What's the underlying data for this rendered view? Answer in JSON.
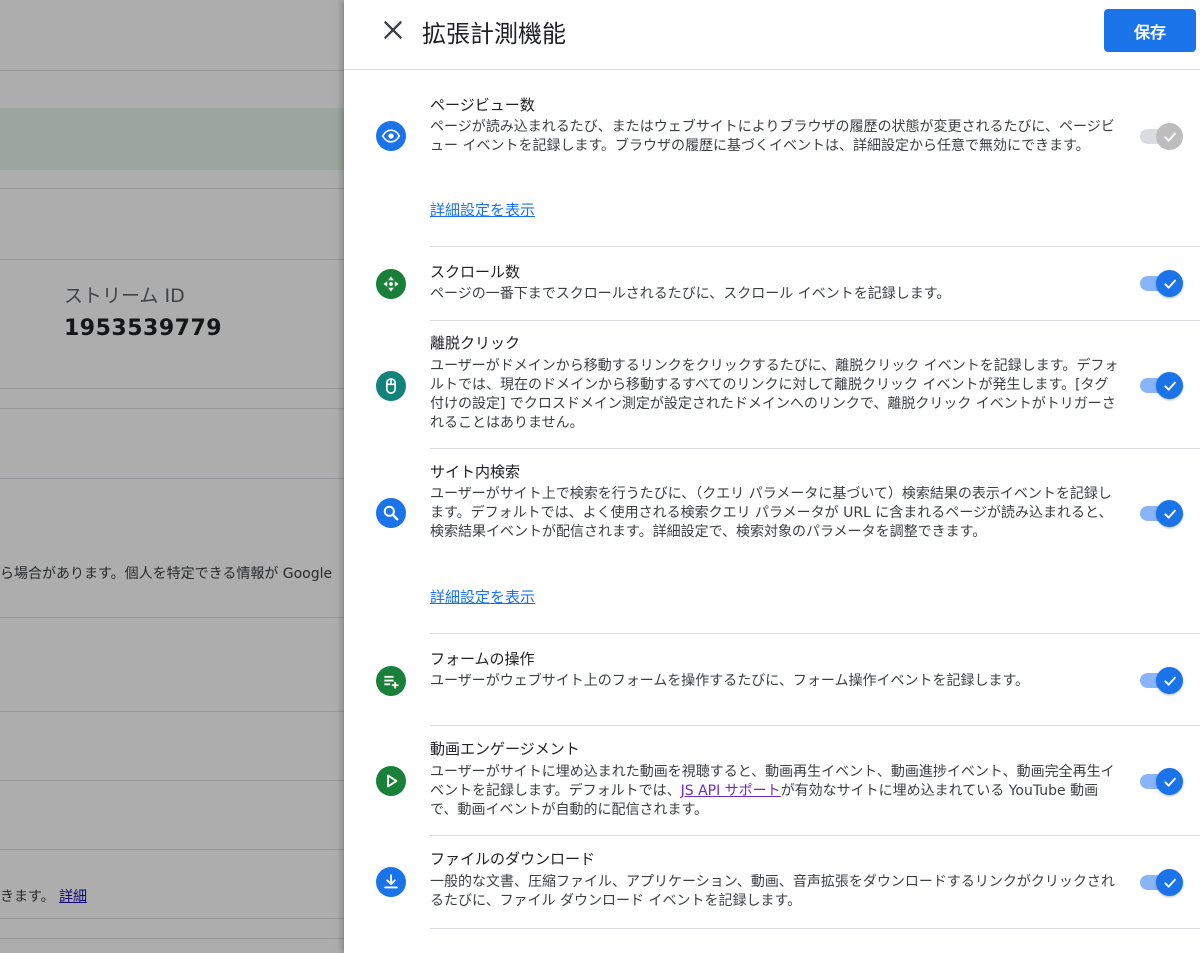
{
  "background": {
    "stream_label": "ストリーム ID",
    "stream_id": "1953539779",
    "note_fragment": "ら場合があります。個人を特定できる情報が Google",
    "note2_text": "きます。",
    "note2_link": "詳細"
  },
  "panel": {
    "title": "拡張計測機能",
    "save_label": "保存",
    "close_icon": "close-icon",
    "advanced_link": "詳細設定を表示"
  },
  "features": [
    {
      "title": "ページビュー数",
      "description": "ページが読み込まれるたび、またはウェブサイトによりブラウザの履歴の状態が変更されるたびに、ページビュー イベントを記録します。ブラウザの履歴に基づくイベントは、詳細設定から任意で無効にできます。",
      "icon": "eye-icon",
      "icon_color": "#1a73e8",
      "enabled": true,
      "toggle_disabled": true,
      "link": "詳細設定を表示"
    },
    {
      "title": "スクロール数",
      "description": "ページの一番下までスクロールされるたびに、スクロール イベントを記録します。",
      "icon": "scroll-icon",
      "icon_color": "#188038",
      "enabled": true
    },
    {
      "title": "離脱クリック",
      "description": "ユーザーがドメインから移動するリンクをクリックするたびに、離脱クリック イベントを記録します。デフォルトでは、現在のドメインから移動するすべてのリンクに対して離脱クリック イベントが発生します。[タグ付けの設定] でクロスドメイン測定が設定されたドメインへのリンクで、離脱クリック イベントがトリガーされることはありません。",
      "icon": "mouse-icon",
      "icon_color": "#12837a",
      "enabled": true
    },
    {
      "title": "サイト内検索",
      "description": "ユーザーがサイト上で検索を行うたびに、（クエリ パラメータに基づいて）検索結果の表示イベントを記録します。デフォルトでは、よく使用される検索クエリ パラメータが URL に含まれるページが読み込まれると、検索結果イベントが配信されます。詳細設定で、検索対象のパラメータを調整できます。",
      "icon": "search-icon",
      "icon_color": "#1a73e8",
      "enabled": true,
      "link": "詳細設定を表示"
    },
    {
      "title": "フォームの操作",
      "description": "ユーザーがウェブサイト上のフォームを操作するたびに、フォーム操作イベントを記録します。",
      "icon": "form-add-icon",
      "icon_color": "#188038",
      "enabled": true
    },
    {
      "title": "動画エンゲージメント",
      "description_before": "ユーザーがサイトに埋め込まれた動画を視聴すると、動画再生イベント、動画進捗イベント、動画完全再生イベントを記録します。デフォルトでは、",
      "description_link": "JS API サポート",
      "description_after": "が有効なサイトに埋め込まれている YouTube 動画で、動画イベントが自動的に配信されます。",
      "icon": "play-icon",
      "icon_color": "#188038",
      "enabled": true
    },
    {
      "title": "ファイルのダウンロード",
      "description": "一般的な文書、圧縮ファイル、アプリケーション、動画、音声拡張をダウンロードするリンクがクリックされるたびに、ファイル ダウンロード イベントを記録します。",
      "icon": "download-icon",
      "icon_color": "#1a73e8",
      "enabled": true
    }
  ]
}
